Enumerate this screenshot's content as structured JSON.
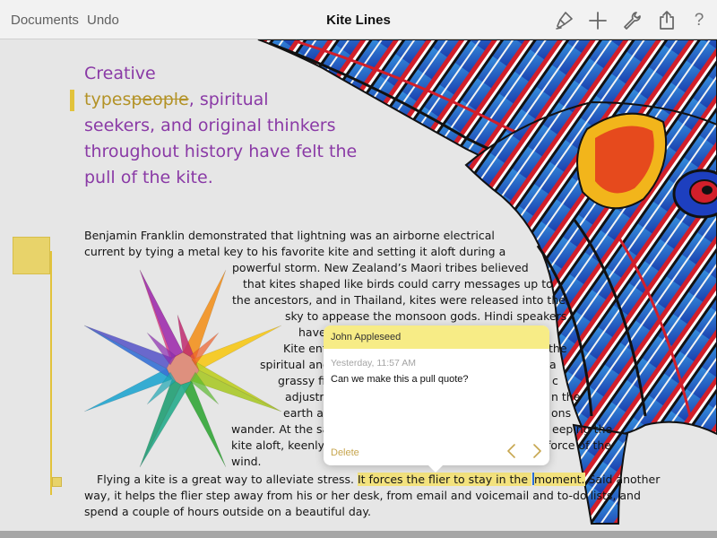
{
  "toolbar": {
    "documents_label": "Documents",
    "undo_label": "Undo",
    "title": "Kite Lines",
    "icons": [
      "brush-icon",
      "plus-icon",
      "wrench-icon",
      "share-icon",
      "help-icon"
    ],
    "help_glyph": "?"
  },
  "pull_quote": {
    "line1": "Creative",
    "line2_insert": "types",
    "line2_deleted": "people",
    "line2_rest": ", spiritual",
    "line3": "seekers, and original thinkers",
    "line4": "throughout history have felt the",
    "line5": "pull of the kite."
  },
  "body": {
    "lines": [
      "Benjamin Franklin demonstrated that lightning was an airborne electrical",
      "current by tying a metal key to his favorite kite and setting it aloft during a",
      "powerful storm. New Zealand’s Maori tribes believed",
      "that kites shaped like birds could carry messages up to",
      "the ancestors, and in Thailand, kites were released into the",
      "sky to appease the monsoon gods. Hindi speakers",
      "have co",
      "Kite ent",
      "the",
      "spiritual and",
      "a",
      "grassy fie",
      "c",
      "adjustm",
      "n the",
      "earth an",
      "ons",
      "wander. At the sa",
      "eeping the",
      "kite aloft, keenly a",
      "force of the",
      "wind."
    ],
    "last_para_pre": "Flying a kite is a great way to alleviate stress. ",
    "last_para_hl_a": "It forces the flier to stay in the",
    "last_para_hl_b": "moment.",
    "last_para_post": " Said another",
    "last_line_2": "way, it helps the flier step away from his or her desk, from email and voicemail and to-do lists, and",
    "last_line_3": "spend a couple of hours outside on a beautiful day."
  },
  "comment": {
    "author": "John Appleseed",
    "timestamp": "Yesterday, 11:57 AM",
    "text": "Can we make this a pull quote?",
    "delete_label": "Delete"
  },
  "colors": {
    "accent_purple": "#8a3aa6",
    "change_gold": "#b39226",
    "highlight": "#f3e27d",
    "comment_header": "#f7ec86"
  }
}
